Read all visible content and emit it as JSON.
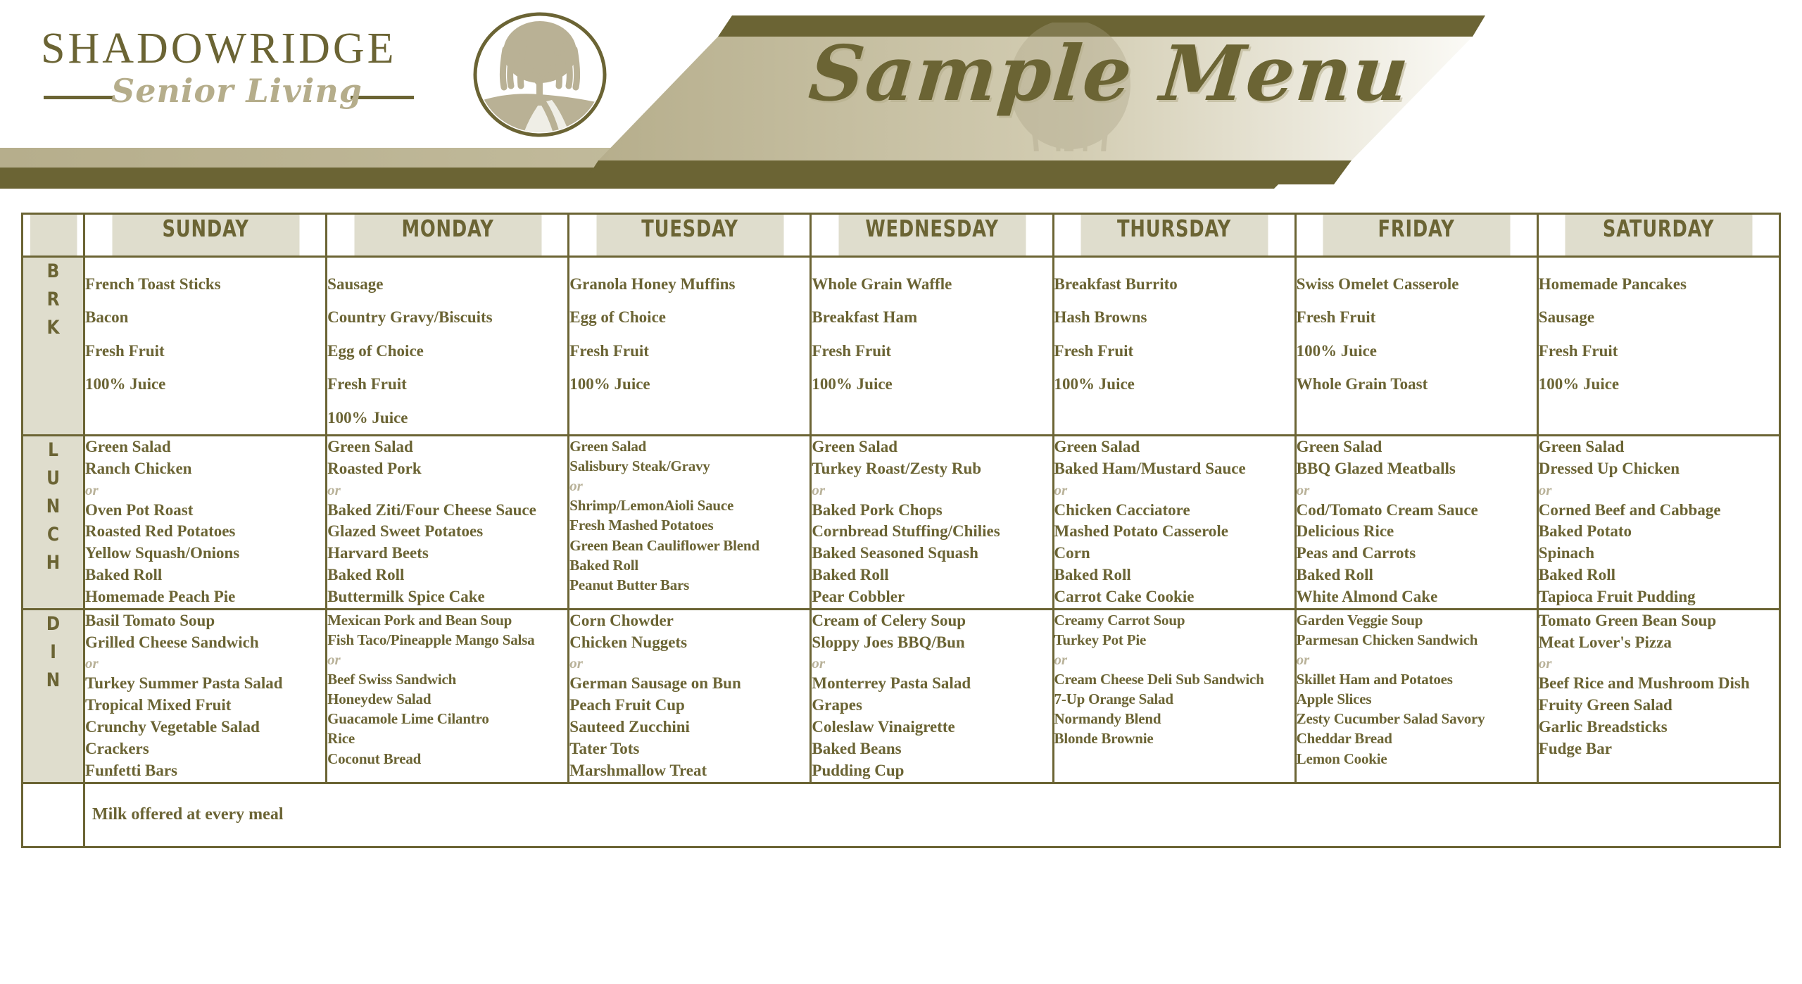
{
  "brand": {
    "name": "SHADOWRIDGE",
    "tagline": "Senior Living",
    "emblem_icon": "willow-tree-emblem-icon"
  },
  "banner": {
    "title": "Sample Menu"
  },
  "colors": {
    "ink": "#6b6434",
    "beige": "#dfddcd",
    "tan": "#b5ad8b",
    "or_text": "#b9b299"
  },
  "table": {
    "corner_label": "",
    "day_headers": [
      "SUNDAY",
      "MONDAY",
      "TUESDAY",
      "WEDNESDAY",
      "THURSDAY",
      "FRIDAY",
      "SATURDAY"
    ],
    "meal_labels": [
      "BRK",
      "LUNCH",
      "DIN"
    ],
    "footer_note": "Milk offered at every meal",
    "rows": {
      "breakfast": [
        [
          "French Toast Sticks",
          "Bacon",
          "Fresh Fruit",
          "100% Juice"
        ],
        [
          "Sausage",
          "Country Gravy/Biscuits",
          "Egg of Choice",
          "Fresh Fruit",
          "100% Juice"
        ],
        [
          "Granola Honey Muffins",
          "Egg of Choice",
          "Fresh Fruit",
          "100% Juice"
        ],
        [
          "Whole Grain Waffle",
          "Breakfast Ham",
          "Fresh Fruit",
          "100% Juice"
        ],
        [
          "Breakfast Burrito",
          "Hash Browns",
          "Fresh Fruit",
          "100% Juice"
        ],
        [
          "Swiss Omelet Casserole",
          "Fresh Fruit",
          "100% Juice",
          "Whole Grain Toast"
        ],
        [
          "Homemade Pancakes",
          "Sausage",
          "Fresh Fruit",
          "100% Juice"
        ]
      ],
      "lunch": [
        [
          "Green Salad",
          "Ranch Chicken",
          "or",
          "Oven Pot Roast",
          "Roasted Red Potatoes",
          "Yellow Squash/Onions",
          "Baked Roll",
          "Homemade Peach Pie"
        ],
        [
          "Green Salad",
          "Roasted Pork",
          "or",
          "Baked Ziti/Four Cheese Sauce",
          "Glazed Sweet Potatoes",
          "Harvard Beets",
          "Baked Roll",
          "Buttermilk Spice Cake"
        ],
        [
          "Green Salad",
          "Salisbury Steak/Gravy",
          "or",
          "Shrimp/LemonAioli Sauce",
          "Fresh Mashed Potatoes",
          "Green Bean Cauliflower Blend",
          "Baked Roll",
          "Peanut Butter Bars"
        ],
        [
          "Green Salad",
          "Turkey Roast/Zesty Rub",
          "or",
          "Baked Pork Chops",
          "Cornbread Stuffing/Chilies",
          "Baked Seasoned Squash",
          "Baked Roll",
          "Pear Cobbler"
        ],
        [
          "Green Salad",
          "Baked Ham/Mustard Sauce",
          "or",
          "Chicken Cacciatore",
          "Mashed Potato Casserole",
          "Corn",
          "Baked Roll",
          "Carrot Cake Cookie"
        ],
        [
          "Green Salad",
          "BBQ Glazed Meatballs",
          "or",
          "Cod/Tomato Cream Sauce",
          "Delicious Rice",
          "Peas and Carrots",
          "Baked Roll",
          "White Almond Cake"
        ],
        [
          "Green Salad",
          "Dressed Up Chicken",
          "or",
          "Corned Beef and Cabbage",
          "Baked Potato",
          "Spinach",
          "Baked Roll",
          "Tapioca Fruit Pudding"
        ]
      ],
      "dinner": [
        [
          "Basil Tomato Soup",
          "Grilled Cheese Sandwich",
          "or",
          "Turkey Summer Pasta Salad",
          "Tropical Mixed Fruit",
          "Crunchy Vegetable Salad",
          "Crackers",
          "Funfetti Bars"
        ],
        [
          "Mexican Pork and Bean Soup",
          "Fish Taco/Pineapple Mango Salsa",
          "or",
          "Beef Swiss Sandwich",
          "Honeydew Salad",
          "Guacamole  Lime Cilantro",
          "Rice",
          "Coconut Bread"
        ],
        [
          "Corn Chowder",
          "Chicken Nuggets",
          "or",
          "German Sausage on Bun",
          "Peach Fruit Cup",
          "Sauteed Zucchini",
          "Tater Tots",
          "Marshmallow Treat"
        ],
        [
          "Cream of Celery Soup",
          "Sloppy Joes BBQ/Bun",
          "or",
          "Monterrey Pasta Salad",
          "Grapes",
          "Coleslaw Vinaigrette",
          "Baked Beans",
          "Pudding Cup"
        ],
        [
          "Creamy Carrot Soup",
          "Turkey Pot Pie",
          "or",
          "Cream Cheese Deli Sub Sandwich",
          "7-Up Orange Salad",
          "Normandy Blend",
          "Blonde Brownie"
        ],
        [
          "Garden Veggie Soup",
          "Parmesan Chicken Sandwich",
          "or",
          "Skillet Ham and Potatoes",
          "Apple Slices",
          "Zesty Cucumber Salad Savory",
          "Cheddar Bread",
          "Lemon Cookie"
        ],
        [
          "Tomato Green Bean Soup",
          "Meat Lover's Pizza",
          "or",
          "Beef Rice and Mushroom Dish",
          "Fruity Green Salad",
          "Garlic Breadsticks",
          "Fudge Bar"
        ]
      ]
    }
  }
}
